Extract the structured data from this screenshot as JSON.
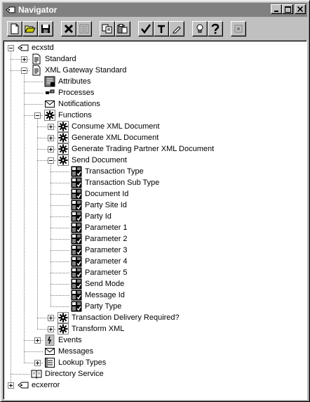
{
  "window": {
    "title": "Navigator",
    "title_buttons": [
      "minimize",
      "maximize",
      "close"
    ]
  },
  "toolbar": {
    "buttons": [
      {
        "name": "new",
        "icon": "new-document-icon"
      },
      {
        "name": "open",
        "icon": "open-folder-icon"
      },
      {
        "name": "save",
        "icon": "save-disk-icon"
      },
      {
        "name": "delete",
        "icon": "delete-x-icon"
      },
      {
        "name": "properties",
        "icon": "properties-icon",
        "enabled": false
      },
      {
        "name": "copy",
        "icon": "copy-icon"
      },
      {
        "name": "paste",
        "icon": "paste-icon"
      },
      {
        "name": "verify",
        "icon": "check-icon"
      },
      {
        "name": "upload",
        "icon": "upload-arrow-icon"
      },
      {
        "name": "edit",
        "icon": "pencil-icon"
      },
      {
        "name": "hint",
        "icon": "lightbulb-icon"
      },
      {
        "name": "help",
        "icon": "help-question-icon"
      },
      {
        "name": "stop",
        "icon": "stop-icon",
        "enabled": false
      }
    ]
  },
  "tree": {
    "items": [
      {
        "label": "ecxstd",
        "icon": "item-type-icon",
        "depth": 0,
        "expander": "-"
      },
      {
        "label": "Standard",
        "icon": "document-icon",
        "depth": 1,
        "expander": "+"
      },
      {
        "label": "XML Gateway Standard",
        "icon": "document-icon",
        "depth": 1,
        "expander": "-"
      },
      {
        "label": "Attributes",
        "icon": "attributes-icon",
        "depth": 2,
        "expander": ""
      },
      {
        "label": "Processes",
        "icon": "processes-icon",
        "depth": 2,
        "expander": ""
      },
      {
        "label": "Notifications",
        "icon": "envelope-icon",
        "depth": 2,
        "expander": ""
      },
      {
        "label": "Functions",
        "icon": "gear-icon",
        "depth": 2,
        "expander": "-"
      },
      {
        "label": "Consume XML Document",
        "icon": "gear-icon",
        "depth": 3,
        "expander": "+"
      },
      {
        "label": "Generate  XML Document",
        "icon": "gear-icon",
        "depth": 3,
        "expander": "+"
      },
      {
        "label": "Generate Trading Partner XML Document",
        "icon": "gear-icon",
        "depth": 3,
        "expander": "+"
      },
      {
        "label": "Send Document",
        "icon": "gear-icon",
        "depth": 3,
        "expander": "-"
      },
      {
        "label": "Transaction Type",
        "icon": "attribute-icon",
        "depth": 4,
        "expander": ""
      },
      {
        "label": "Transaction Sub Type",
        "icon": "attribute-icon",
        "depth": 4,
        "expander": ""
      },
      {
        "label": "Document Id",
        "icon": "attribute-icon",
        "depth": 4,
        "expander": ""
      },
      {
        "label": "Party Site Id",
        "icon": "attribute-icon",
        "depth": 4,
        "expander": ""
      },
      {
        "label": "Party Id",
        "icon": "attribute-icon",
        "depth": 4,
        "expander": ""
      },
      {
        "label": "Parameter 1",
        "icon": "attribute-icon",
        "depth": 4,
        "expander": ""
      },
      {
        "label": "Parameter 2",
        "icon": "attribute-icon",
        "depth": 4,
        "expander": ""
      },
      {
        "label": "Parameter 3",
        "icon": "attribute-icon",
        "depth": 4,
        "expander": ""
      },
      {
        "label": "Parameter 4",
        "icon": "attribute-icon",
        "depth": 4,
        "expander": ""
      },
      {
        "label": "Parameter 5",
        "icon": "attribute-icon",
        "depth": 4,
        "expander": ""
      },
      {
        "label": "Send Mode",
        "icon": "attribute-icon",
        "depth": 4,
        "expander": ""
      },
      {
        "label": "Message Id",
        "icon": "attribute-icon",
        "depth": 4,
        "expander": ""
      },
      {
        "label": "Party Type",
        "icon": "attribute-icon",
        "depth": 4,
        "expander": ""
      },
      {
        "label": "Transaction  Delivery Required?",
        "icon": "gear-icon",
        "depth": 3,
        "expander": "+"
      },
      {
        "label": "Transform XML",
        "icon": "gear-icon",
        "depth": 3,
        "expander": "+"
      },
      {
        "label": "Events",
        "icon": "events-icon",
        "depth": 2,
        "expander": "+"
      },
      {
        "label": "Messages",
        "icon": "envelope-icon",
        "depth": 2,
        "expander": ""
      },
      {
        "label": "Lookup Types",
        "icon": "lookup-icon",
        "depth": 2,
        "expander": "+"
      },
      {
        "label": "Directory Service",
        "icon": "book-icon",
        "depth": 1,
        "expander": ""
      },
      {
        "label": "ecxerror",
        "icon": "item-type-icon",
        "depth": 0,
        "expander": "+"
      }
    ]
  },
  "colors": {
    "face": "#c0c0c0",
    "titlebar_inactive": "#808080",
    "tree_bg": "#ffffff",
    "shadow": "#808080"
  }
}
